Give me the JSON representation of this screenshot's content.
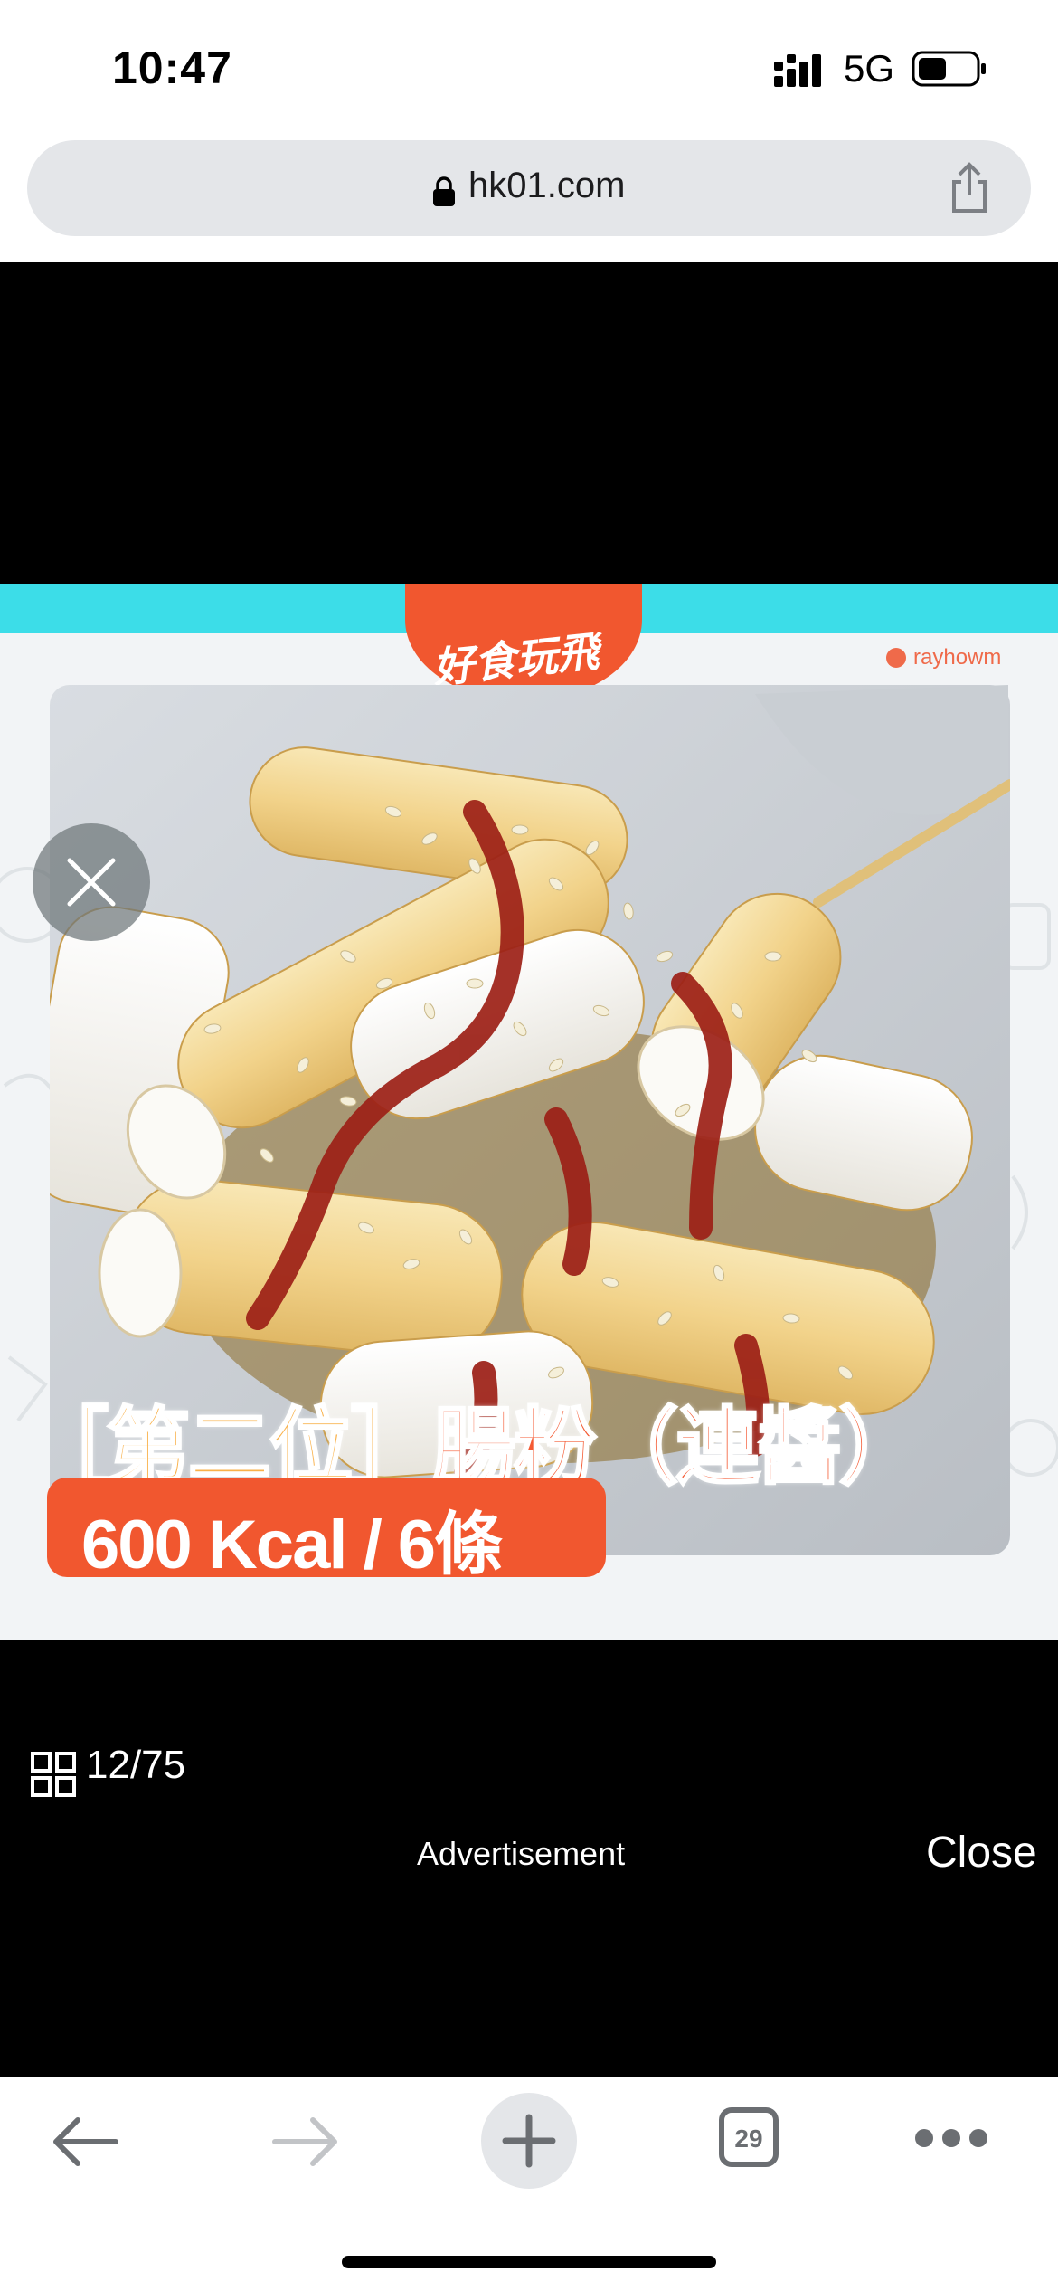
{
  "status_bar": {
    "time": "10:47",
    "network": "5G"
  },
  "browser": {
    "url": "hk01.com",
    "tab_count": "29"
  },
  "viewer": {
    "brand_logo_text": "好食玩飛",
    "photo_credit": "rayhowm",
    "headline_part1": "［第二位］",
    "headline_part2": "腸粉（連醬）",
    "kcal_badge": "600 Kcal / 6條",
    "counter": "12/75",
    "advertisement_label": "Advertisement",
    "close_label": "Close"
  },
  "colors": {
    "teal": "#3cdde8",
    "brand_orange": "#f1572f",
    "headline_yellow": "#f9b14a"
  }
}
